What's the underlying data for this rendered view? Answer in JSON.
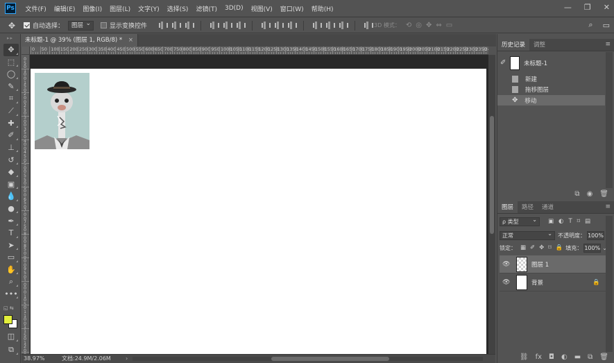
{
  "app": {
    "logo": "Ps"
  },
  "menu": [
    "文件(F)",
    "编辑(E)",
    "图像(I)",
    "图层(L)",
    "文字(Y)",
    "选择(S)",
    "滤镜(T)",
    "3D(D)",
    "视图(V)",
    "窗口(W)",
    "帮助(H)"
  ],
  "window_controls": [
    "minimize-icon",
    "restore-icon",
    "close-icon"
  ],
  "options": {
    "auto_select_label": "自动选择：",
    "auto_select_checked": true,
    "auto_select_value": "图层",
    "show_transform_label": "显示变换控件",
    "show_transform_checked": false,
    "mode_3d_label": "3D 模式："
  },
  "document": {
    "tab_title": "未标题-1 @ 39% (图层 1, RGB/8) *",
    "zoom": "38.97%",
    "doc_info": "文档:24.9M/2.06M"
  },
  "ruler": {
    "top": [
      "0",
      "50",
      "100",
      "150",
      "200",
      "250",
      "300",
      "350",
      "400",
      "450",
      "500",
      "550",
      "600",
      "650",
      "700",
      "750",
      "800",
      "850",
      "900",
      "950",
      "1000",
      "1050",
      "1100",
      "1150",
      "1200",
      "1250",
      "1300",
      "1350",
      "1400",
      "1450",
      "1500",
      "1550",
      "1600",
      "1650",
      "1700",
      "1750",
      "1800",
      "1850",
      "1900",
      "1950",
      "2000",
      "2050",
      "2100",
      "2150",
      "2200",
      "2250",
      "2300",
      "2350",
      "2400"
    ],
    "left": [
      "0",
      "5",
      "0",
      "1",
      "0",
      "0",
      "1",
      "5",
      "0",
      "2",
      "0",
      "0",
      "2",
      "5",
      "0",
      "3",
      "0",
      "0",
      "3",
      "5",
      "0",
      "4",
      "0",
      "0",
      "4",
      "5",
      "0",
      "5",
      "0",
      "0",
      "5",
      "5",
      "0",
      "6",
      "0",
      "0",
      "6",
      "5",
      "0",
      "7",
      "0",
      "0",
      "7",
      "5",
      "0",
      "8",
      "0",
      "0",
      "8",
      "5",
      "0",
      "9",
      "0",
      "0",
      "9",
      "5",
      "0",
      "1",
      "0",
      "0",
      "0",
      "1",
      "0",
      "5",
      "0",
      "1",
      "1",
      "0",
      "0",
      "1",
      "1",
      "5",
      "0",
      "1",
      "2",
      "0",
      "0"
    ]
  },
  "colors": {
    "foreground": "#e3ef3c",
    "background": "#ffffff",
    "accent": "#31a8ff"
  },
  "history_panel": {
    "tabs": [
      "历史记录",
      "调整"
    ],
    "snapshot": "未标题-1",
    "items": [
      {
        "label": "新建",
        "icon": "document-icon"
      },
      {
        "label": "拖移图层",
        "icon": "document-icon"
      },
      {
        "label": "移动",
        "icon": "move-icon"
      }
    ]
  },
  "layers_panel": {
    "tabs": [
      "图层",
      "路径",
      "通道"
    ],
    "kind_label": "ρ 类型",
    "blend_mode": "正常",
    "opacity_label": "不透明度：",
    "opacity_value": "100%",
    "lock_label": "锁定：",
    "fill_label": "填充：",
    "fill_value": "100%",
    "layers": [
      {
        "name": "图层 1",
        "selected": true
      },
      {
        "name": "背景",
        "selected": false,
        "locked": true
      }
    ]
  }
}
